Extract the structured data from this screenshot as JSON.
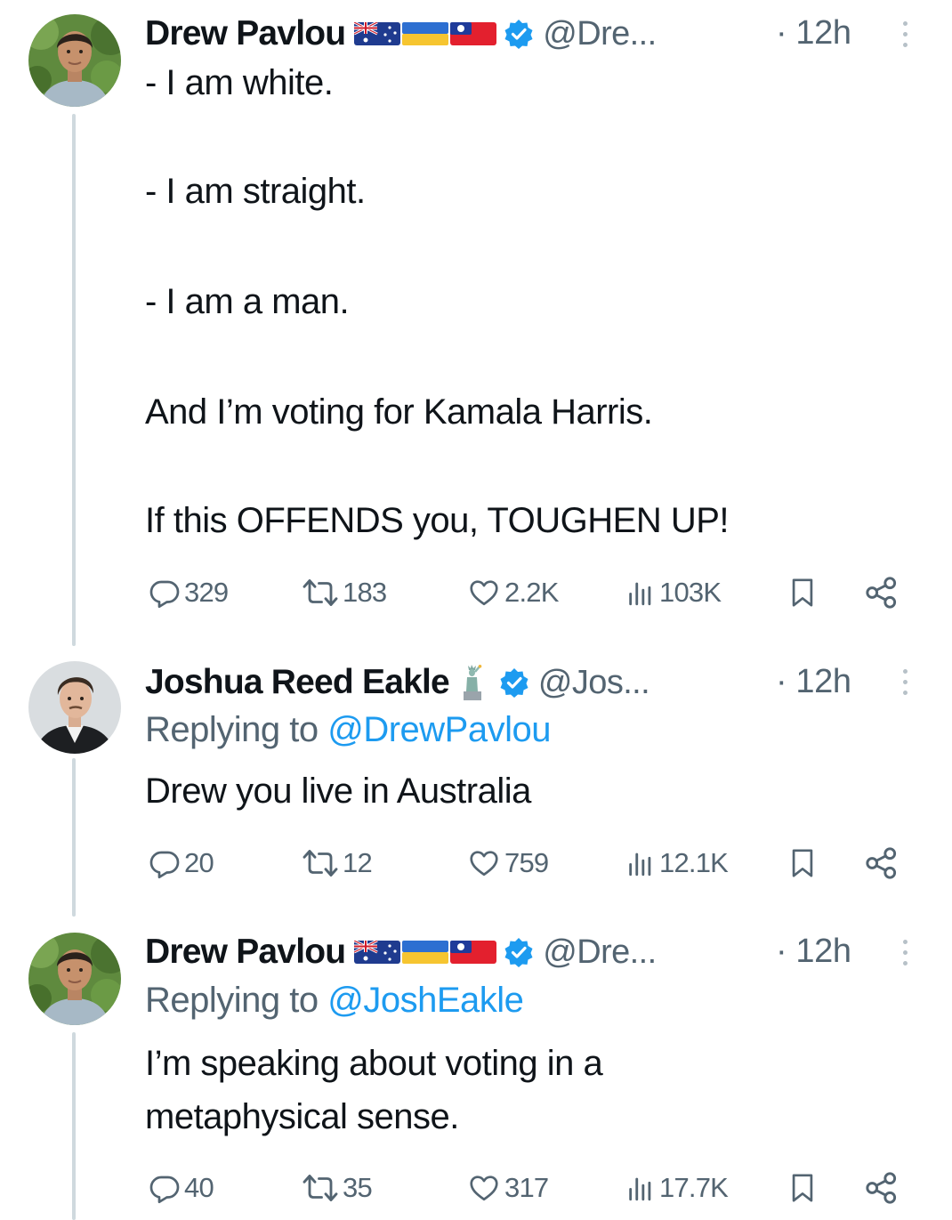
{
  "colors": {
    "text": "#0f1419",
    "muted": "#536471",
    "accent": "#1d9bf0",
    "thread_line": "#cfd9de"
  },
  "tweets": [
    {
      "name": "Drew Pavlou",
      "flags": [
        "australia-flag",
        "ukraine-flag",
        "taiwan-flag"
      ],
      "verified": true,
      "handle": "@Dre...",
      "time": "· 12h",
      "replying_prefix": "",
      "replying_mention": "",
      "text_lines": [
        "- I am white.",
        "- I am straight.",
        "- I am a man.",
        "And I’m voting for Kamala Harris.",
        "If this OFFENDS you, TOUGHEN UP!"
      ],
      "stats": {
        "replies": "329",
        "reposts": "183",
        "likes": "2.2K",
        "views": "103K"
      }
    },
    {
      "name": "Joshua Reed Eakle",
      "flags": [
        "statue-of-liberty-emoji"
      ],
      "verified": true,
      "handle": "@Jos...",
      "time": "· 12h",
      "replying_prefix": "Replying to ",
      "replying_mention": "@DrewPavlou",
      "text_lines": [
        "Drew you live in Australia"
      ],
      "stats": {
        "replies": "20",
        "reposts": "12",
        "likes": "759",
        "views": "12.1K"
      }
    },
    {
      "name": "Drew Pavlou",
      "flags": [
        "australia-flag",
        "ukraine-flag",
        "taiwan-flag"
      ],
      "verified": true,
      "handle": "@Dre...",
      "time": "· 12h",
      "replying_prefix": "Replying to ",
      "replying_mention": "@JoshEakle",
      "text_lines": [
        "I’m speaking about voting in a",
        "metaphysical sense."
      ],
      "stats": {
        "replies": "40",
        "reposts": "35",
        "likes": "317",
        "views": "17.7K"
      }
    }
  ]
}
